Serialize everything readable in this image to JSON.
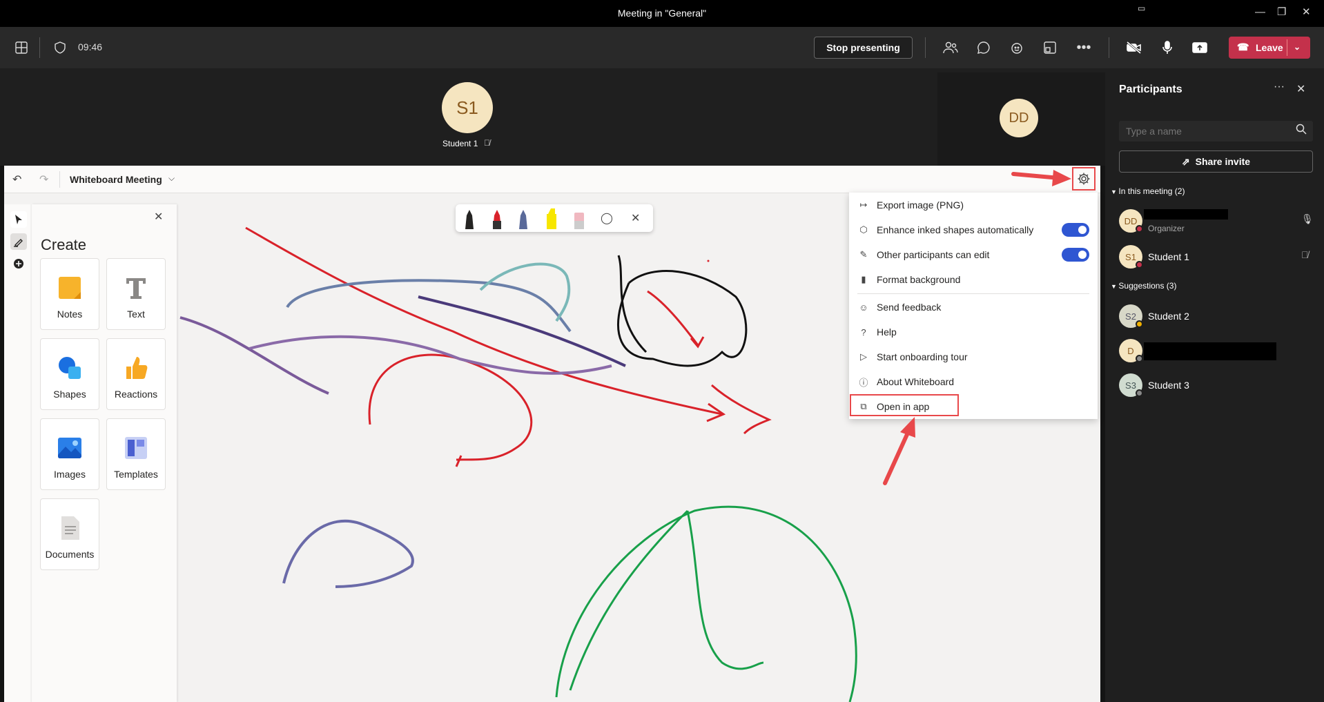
{
  "window": {
    "title": "Meeting in \"General\""
  },
  "toolbar": {
    "time": "09:46",
    "stop_label": "Stop presenting",
    "leave_label": "Leave"
  },
  "stage": {
    "presenter_initials": "S1",
    "presenter_name": "Student 1",
    "other_initials": "DD"
  },
  "whiteboard": {
    "title": "Whiteboard Meeting",
    "create_title": "Create",
    "tiles": [
      {
        "label": "Notes"
      },
      {
        "label": "Text"
      },
      {
        "label": "Shapes"
      },
      {
        "label": "Reactions"
      },
      {
        "label": "Images"
      },
      {
        "label": "Templates"
      },
      {
        "label": "Documents"
      }
    ]
  },
  "settings_menu": {
    "items": [
      {
        "label": "Export image (PNG)",
        "icon": "export-icon"
      },
      {
        "label": "Enhance inked shapes automatically",
        "icon": "shapes-icon",
        "toggle": true
      },
      {
        "label": "Other participants can edit",
        "icon": "pencil-icon",
        "toggle": true
      },
      {
        "label": "Format background",
        "icon": "paint-icon"
      },
      {
        "label": "Send feedback",
        "icon": "feedback-icon"
      },
      {
        "label": "Help",
        "icon": "help-icon"
      },
      {
        "label": "Start onboarding tour",
        "icon": "play-icon"
      },
      {
        "label": "About Whiteboard",
        "icon": "info-icon"
      },
      {
        "label": "Open in app",
        "icon": "open-app-icon"
      }
    ]
  },
  "participants": {
    "title": "Participants",
    "search_placeholder": "Type a name",
    "share_label": "Share invite",
    "in_meeting_label": "In this meeting (2)",
    "suggestions_label": "Suggestions (3)",
    "organizer_initials": "DD",
    "organizer_role": "Organizer",
    "student1_initials": "S1",
    "student1_name": "Student 1",
    "student2_initials": "S2",
    "student2_name": "Student 2",
    "d_initials": "D",
    "student3_initials": "S3",
    "student3_name": "Student 3"
  },
  "colors": {
    "accent": "#2f56d2",
    "leave": "#c4314b",
    "annotation": "#e8484a"
  }
}
